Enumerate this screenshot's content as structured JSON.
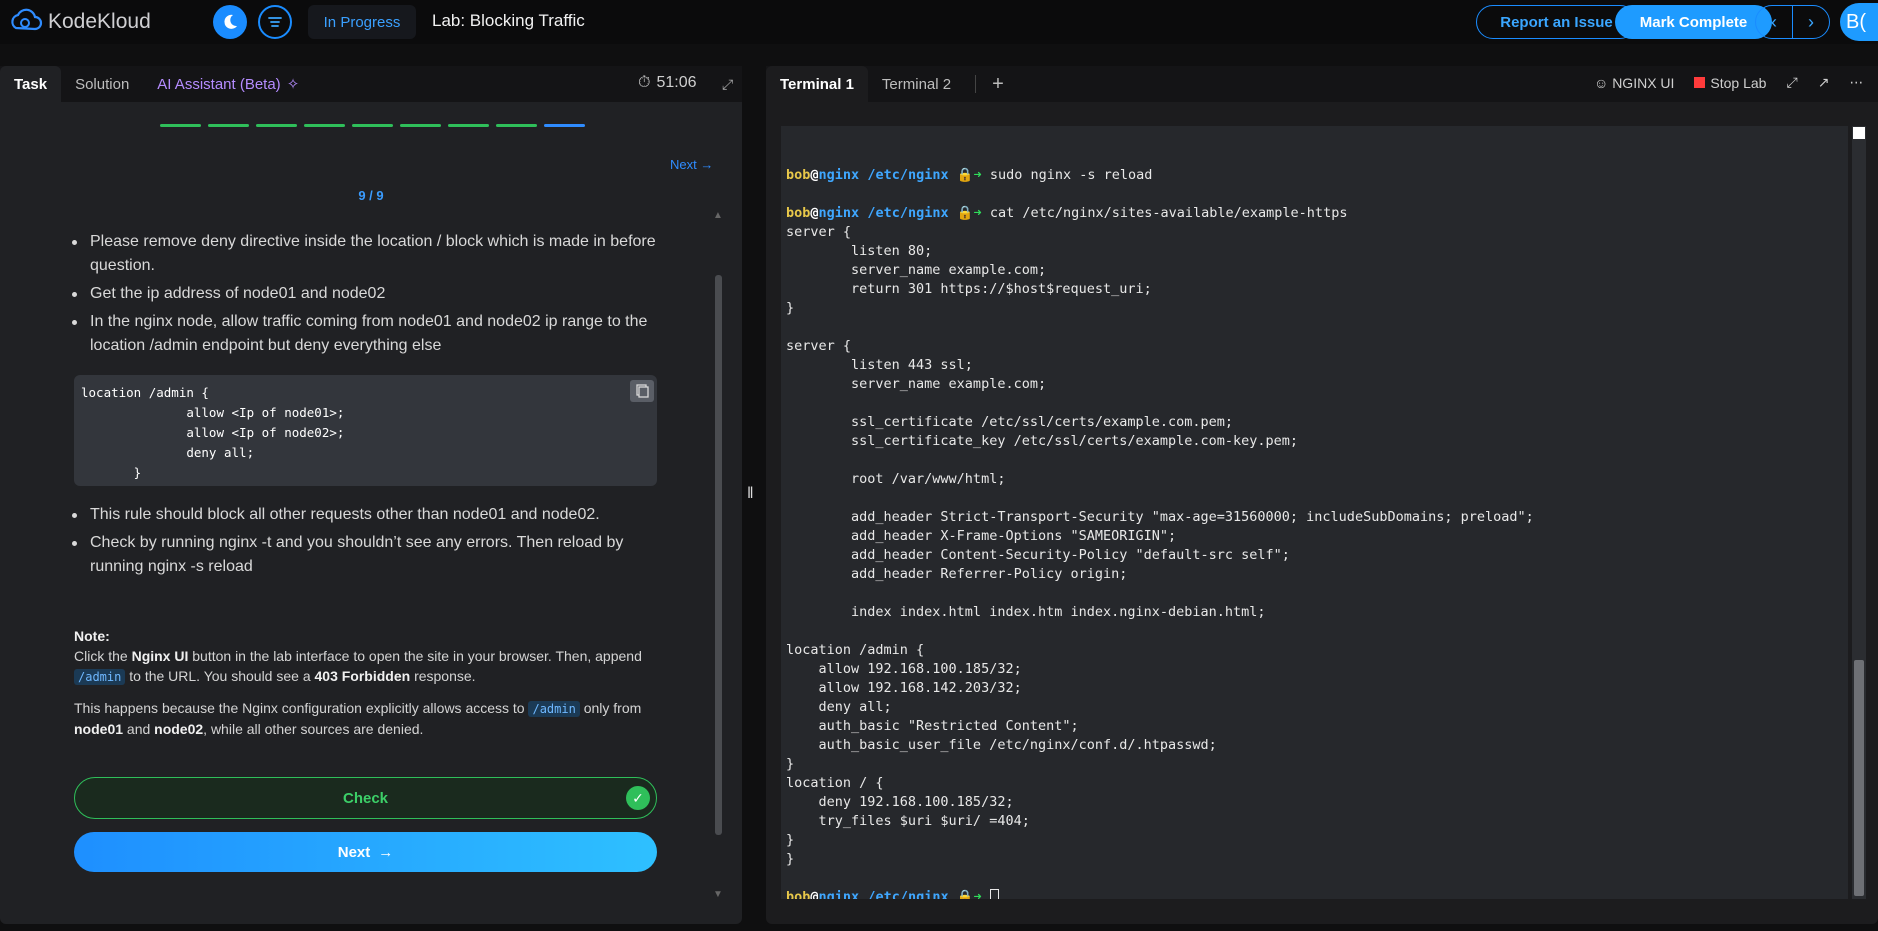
{
  "header": {
    "brand": "KodeKloud",
    "status": "In Progress",
    "lab_title": "Lab: Blocking Traffic",
    "report_label": "Report an Issue",
    "complete_label": "Mark Complete",
    "avatar_initials": "B("
  },
  "left_panel": {
    "tabs": [
      {
        "label": "Task"
      },
      {
        "label": "Solution"
      },
      {
        "label": "AI Assistant (Beta)"
      }
    ],
    "timer": "51:06",
    "progress": {
      "completed": 8,
      "current": 9,
      "total": 9
    },
    "next_link": "Next →",
    "step_count": "9 / 9",
    "bullets_a": [
      "Please remove deny directive inside the location / block which is made in before question.",
      "Get the ip address of node01 and node02",
      "In the nginx node, allow traffic coming from node01 and node02 ip range to the location /admin endpoint but deny everything else"
    ],
    "code": "location /admin {\n              allow <Ip of node01>;\n              allow <Ip of node02>;\n              deny all;\n       }",
    "bullets_b": [
      "This rule should block all other requests other than node01 and node02.",
      "Check by running nginx -t and you shouldn’t see any errors. Then reload by running nginx -s reload"
    ],
    "note": {
      "label": "Note:",
      "p1_a": "Click the ",
      "p1_b": "Nginx UI",
      "p1_c": " button in the lab interface to open the site in your browser. Then, append ",
      "p1_code": "/admin",
      "p1_d": " to the URL. You should see a ",
      "p1_e": "403 Forbidden",
      "p1_f": " response.",
      "p2_a": "This happens because the Nginx configuration explicitly allows access to ",
      "p2_code": "/admin",
      "p2_b": " only from ",
      "p2_c": "node01",
      "p2_d": " and ",
      "p2_e": "node02",
      "p2_f": ", while all other sources are denied."
    },
    "check_label": "Check",
    "next_label": "Next"
  },
  "right_panel": {
    "tabs": [
      {
        "label": "Terminal 1"
      },
      {
        "label": "Terminal 2"
      }
    ],
    "nginx_ui": "NGINX UI",
    "stop_lab": "Stop Lab",
    "prompt": {
      "user": "bob",
      "host": "nginx",
      "path": "/etc/nginx"
    },
    "cmd1": "sudo nginx -s reload",
    "cmd2": "cat /etc/nginx/sites-available/example-https",
    "output": "server {\n        listen 80;\n        server_name example.com;\n        return 301 https://$host$request_uri;\n}\n\nserver {\n        listen 443 ssl;\n        server_name example.com;\n\n        ssl_certificate /etc/ssl/certs/example.com.pem;\n        ssl_certificate_key /etc/ssl/certs/example.com-key.pem;\n\n        root /var/www/html;\n\n        add_header Strict-Transport-Security \"max-age=31560000; includeSubDomains; preload\";\n        add_header X-Frame-Options \"SAMEORIGIN\";\n        add_header Content-Security-Policy \"default-src self\";\n        add_header Referrer-Policy origin;\n\n        index index.html index.htm index.nginx-debian.html;\n\nlocation /admin {\n    allow 192.168.100.185/32;\n    allow 192.168.142.203/32;\n    deny all;\n    auth_basic \"Restricted Content\";\n    auth_basic_user_file /etc/nginx/conf.d/.htpasswd;\n}\nlocation / {\n    deny 192.168.100.185/32;\n    try_files $uri $uri/ =404;\n}\n}"
  },
  "colors": {
    "accent": "#1e9bff",
    "success": "#2fbf5a",
    "ai": "#b58cff",
    "stop": "#ff3b3b"
  }
}
